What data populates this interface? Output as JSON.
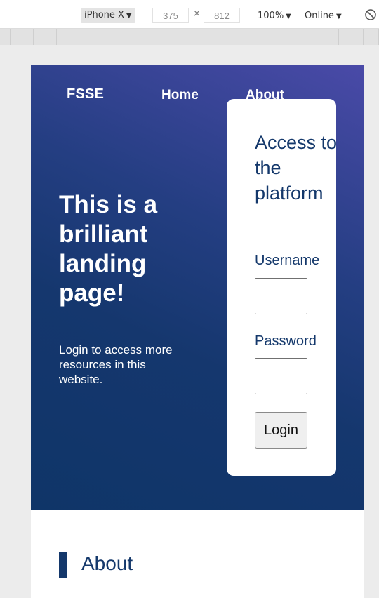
{
  "devtools": {
    "device": "iPhone X",
    "width": "375",
    "times": "×",
    "height": "812",
    "zoom": "100%",
    "network": "Online",
    "caret": "▼",
    "icons": {
      "throttle": "no-throttle-icon"
    }
  },
  "nav": {
    "brand": "FSSE",
    "items": [
      {
        "label": "Home"
      },
      {
        "label": "About"
      }
    ]
  },
  "hero": {
    "title": "This is a brilliant landing page!",
    "subtitle": "Login to access more resources in this website."
  },
  "login": {
    "title": "Access to the platform",
    "username_label": "Username",
    "username_value": "",
    "password_label": "Password",
    "password_value": "",
    "button_label": "Login"
  },
  "about": {
    "heading": "About"
  },
  "colors": {
    "brand_navy": "#14386b",
    "hero_gradient_light": "#4a4aa8",
    "hero_gradient_dark": "#0f3568"
  }
}
